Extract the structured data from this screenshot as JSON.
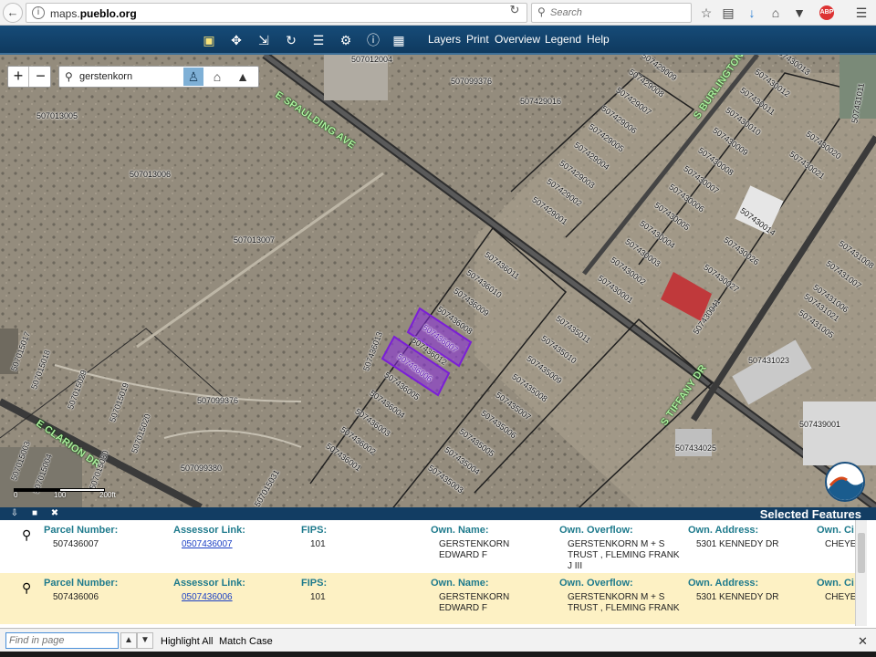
{
  "browser": {
    "url_prefix": "maps.",
    "url_domain": "pueblo.org",
    "search_placeholder": "Search",
    "abp_label": "ABP"
  },
  "app_toolbar": {
    "menus": [
      "Layers",
      "Print",
      "Overview",
      "Legend",
      "Help"
    ]
  },
  "map": {
    "search_value": "gerstenkorn",
    "street_labels": [
      "E SPAULDING AVE",
      "S BURLINGTON",
      "S TIFFANY DR",
      "E CLARION DR"
    ],
    "parcel_labels": [
      "507012004",
      "507099376",
      "507429016",
      "507013005",
      "507013006",
      "507013007",
      "507436013",
      "507099376",
      "507099380",
      "507015031",
      "507015017",
      "507015018",
      "507015019",
      "507015020",
      "507015029",
      "507015030",
      "507015003",
      "507015004",
      "507436011",
      "507436010",
      "507436009",
      "507436008",
      "507436007",
      "507436006",
      "507436012",
      "507436005",
      "507436004",
      "507436003",
      "507436002",
      "507436001",
      "507435011",
      "507435010",
      "507435009",
      "507435008",
      "507435007",
      "507435006",
      "507435005",
      "507435004",
      "507435003",
      "507434025",
      "507431023",
      "507439001",
      "507431006",
      "507431005",
      "507431021",
      "507431007",
      "507431008",
      "507430026",
      "507430027",
      "507430041",
      "507430014",
      "507430020",
      "507430021",
      "507430012",
      "507430011",
      "507430010",
      "507430009",
      "507430008",
      "507430007",
      "507430006",
      "507430005",
      "507430004",
      "507430003",
      "507430002",
      "507430001",
      "507429001",
      "507429002",
      "507429003",
      "507429004",
      "507429005",
      "507429006",
      "507429007",
      "507429008",
      "507429009",
      "507430013",
      "507431011"
    ],
    "scale_labels": [
      "0",
      "100",
      "200ft"
    ]
  },
  "panel": {
    "title": "Selected Features",
    "headers": {
      "parcel": "Parcel Number:",
      "assessor": "Assessor Link:",
      "fips": "FIPS:",
      "owner": "Own. Name:",
      "overflow": "Own. Overflow:",
      "address": "Own. Address:",
      "city": "Own. Ci"
    },
    "rows": [
      {
        "parcel": "507436007",
        "assessor": "0507436007",
        "fips": "101",
        "owner": "GERSTENKORN EDWARD F",
        "overflow": "GERSTENKORN M + S TRUST , FLEMING FRANK J III",
        "address": "5301 KENNEDY DR",
        "city": "CHEYE"
      },
      {
        "parcel": "507436006",
        "assessor": "0507436006",
        "fips": "101",
        "owner": "GERSTENKORN EDWARD F",
        "overflow": "GERSTENKORN M + S TRUST , FLEMING FRANK",
        "address": "5301 KENNEDY DR",
        "city": "CHEYE"
      }
    ]
  },
  "find_bar": {
    "placeholder": "Find in page",
    "highlight_all": "Highlight All",
    "match_case": "Match Case"
  },
  "colors": {
    "toolbar_bg": "#164b78",
    "selected_parcel": "#8a2be2",
    "header_text": "#1e7a8c",
    "link": "#1a3fc4",
    "alt_row": "#fdf1c4"
  }
}
